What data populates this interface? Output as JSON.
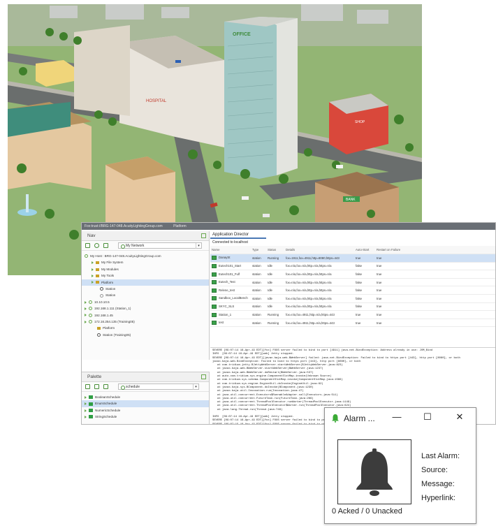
{
  "scene": {
    "sign_office": "OFFICE",
    "sign_hospital": "HOSPITAL",
    "sign_bank": "BANK",
    "sign_shop": "SHOP"
  },
  "workbench": {
    "title_path": "Fox:trust://BRG-147-048.AcuityLightingGroup.com",
    "title_current": "Platform",
    "nav": {
      "header": "Nav",
      "network_select": "My Network",
      "tree": [
        {
          "label": "My Host : BRG-147-048.AcuityLightingGroup.com",
          "icon": "host"
        },
        {
          "label": "My File System",
          "icon": "folder"
        },
        {
          "label": "My Modules",
          "icon": "folder"
        },
        {
          "label": "My Tools",
          "icon": "folder"
        },
        {
          "label": "Platform",
          "icon": "folder",
          "selected": true
        },
        {
          "label": "Station",
          "icon": "station"
        },
        {
          "label": "Station",
          "icon": "station"
        },
        {
          "label": "10.10.10.5",
          "icon": "host"
        },
        {
          "label": "192.168.1.111 (Station_1)",
          "icon": "host"
        },
        {
          "label": "192.168.1.45",
          "icon": "host"
        },
        {
          "label": "172.16.254.135 (Training05)",
          "icon": "host"
        },
        {
          "label": "Platform",
          "icon": "folder"
        },
        {
          "label": "Station (Training05)",
          "icon": "station"
        }
      ]
    },
    "palette": {
      "header": "Palette",
      "select": "schedule",
      "items": [
        {
          "label": "BooleanSchedule"
        },
        {
          "label": "EnumSchedule",
          "selected": true
        },
        {
          "label": "NumericSchedule"
        },
        {
          "label": "StringSchedule"
        }
      ]
    },
    "app_director": {
      "tab": "Application Director",
      "connection": "Connected to localhost",
      "columns": [
        "Name",
        "Type",
        "Status",
        "Details",
        "Auto-Start",
        "Restart on Failure"
      ],
      "rows": [
        {
          "name": "DanaySt",
          "type": "station",
          "status": "Running",
          "details": "fox=1911,fox=4911,http=8080,https=443",
          "auto": "true",
          "restart": "true",
          "selected": true
        },
        {
          "name": "Eutech101_Start",
          "type": "station",
          "status": "Idle",
          "details": "fox=n/a,fox=n/a,http=n/a,https=n/a",
          "auto": "false",
          "restart": "true"
        },
        {
          "name": "Eutech101_Fulf",
          "type": "station",
          "status": "Idle",
          "details": "fox=n/a,fox=n/a,http=n/a,https=n/a",
          "auto": "false",
          "restart": "true"
        },
        {
          "name": "Eutech_Test",
          "type": "station",
          "status": "Idle",
          "details": "fox=n/a,fox=n/a,http=n/a,https=n/a",
          "auto": "false",
          "restart": "true"
        },
        {
          "name": "Relene_test",
          "type": "station",
          "status": "Idle",
          "details": "fox=n/a,fox=n/a,http=n/a,https=n/a",
          "auto": "false",
          "restart": "true"
        },
        {
          "name": "Sandbox_LocalBench",
          "type": "station",
          "status": "Idle",
          "details": "fox=n/a,fox=n/a,http=n/a,https=n/a",
          "auto": "false",
          "restart": "true"
        },
        {
          "name": "SKYC_SLS",
          "type": "station",
          "status": "Idle",
          "details": "fox=n/a,fox=n/a,http=n/a,https=n/a",
          "auto": "false",
          "restart": "true"
        },
        {
          "name": "Station_1",
          "type": "station",
          "status": "Running",
          "details": "fox=n/a,fox=4911,http=n/a,https=443",
          "auto": "true",
          "restart": "true"
        },
        {
          "name": "test",
          "type": "station",
          "status": "Running",
          "details": "fox=n/a,fox=4911,http=n/a,https=443",
          "auto": "true",
          "restart": "true"
        }
      ],
      "log": [
        "SEVERE [09:07:14 16-Apr-19 EDT][fox] FOXS server failed to bind to port [4911] java.net.BindException: Address already in use: JVM_Bind",
        "INFO  [09:07:14 16-Apr-19 EDT][web] Jetty stopped.",
        "SEVERE [09:07:14 16-Apr-19 EDT][javax.baja.web.BWebServer] failed: java.net.BindException: Failed to bind to https port [443], http port [8080], or both",
        "javax.baja.web.BindException: Failed to bind to https port [443], http port [8080], or both",
        "   at com.tridium.jetty.BJettyWebServer.startWebServer(BJettyWebServer.java:823)",
        "   at javax.baja.web.BWebServer.startWebServer(BWebServer.java:1237)",
        "   at javax.baja.web.BWebServer.doRestart(BWebServer.java:537)",
        "   at auto.com.tridium.sys.engine.ComponentSlotMap.invoke(Unknown Source)",
        "   at com.tridium.sys.schema.ComponentSlotMap.invoke(ComponentSlotMap.java:1566)",
        "   at com.tridium.sys.engine.EngineUtil.doInvoke(EngineUtil.java:62)",
        "   at javax.baja.sys.BComponent.doInvoke(BComponent.java:1230)",
        "   at javax.baja.util.Invocation.run(Invocation.java:47)",
        "   at java.util.concurrent.Executors$RunnableAdapter.call(Executors.java:511)",
        "   at java.util.concurrent.FutureTask.run(FutureTask.java:266)",
        "   at java.util.concurrent.ThreadPoolExecutor.runWorker(ThreadPoolExecutor.java:1149)",
        "   at java.util.concurrent.ThreadPoolExecutor$Worker.run(ThreadPoolExecutor.java:624)",
        "   at java.lang.Thread.run(Thread.java:748)",
        "",
        "INFO  [09:07:14 16-Apr-19 EDT][web] Jetty stopped.",
        "SEVERE [09:07:14 16-Apr-19 EDT][fox] FOXS server failed to bind to port [4911] java.net.BindException: Address already in use: JVM_Bind",
        "SEVERE [09:07:15 16-Apr-19 EDT][fox] FOXS server failed to bind to port [4911]",
        "INFO  [09:07:15 16-Apr-19 EDT][web] Jetty stopped."
      ]
    }
  },
  "alarm": {
    "title": "Alarm ...",
    "min_glyph": "—",
    "max_glyph": "☐",
    "close_glyph": "✕",
    "labels": {
      "last_alarm": "Last Alarm:",
      "source": "Source:",
      "message": "Message:",
      "hyperlink": "Hyperlink:"
    },
    "counts": "0 Acked / 0 Unacked",
    "accent_color": "#3aaa35"
  }
}
